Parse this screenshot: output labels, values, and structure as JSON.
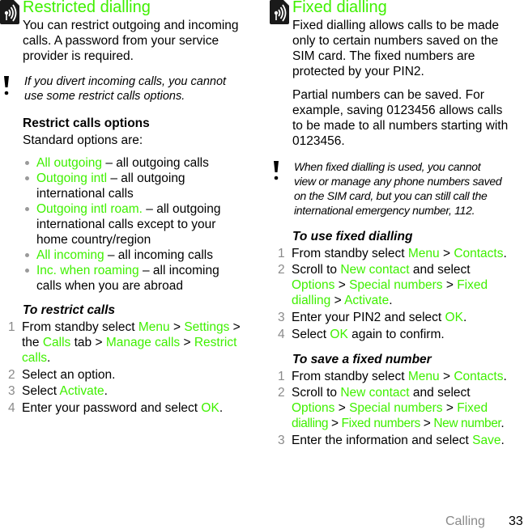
{
  "left": {
    "title": "Restricted dialling",
    "icon": "network-service-icon",
    "intro": [
      "You can restrict outgoing and incoming",
      "calls. A password from your service",
      "provider is required."
    ],
    "note": {
      "icon": "exclamation-icon",
      "lines": [
        "If you divert incoming calls, you cannot",
        "use some restrict calls options."
      ]
    },
    "options_heading": "Restrict calls options",
    "options_intro": "Standard options are:",
    "options": [
      {
        "name": "All outgoing",
        "desc_lines": [
          "– all outgoing calls"
        ]
      },
      {
        "name": "Outgoing intl",
        "desc_lines": [
          "– all outgoing",
          "international calls"
        ]
      },
      {
        "name": "Outgoing intl roam.",
        "desc_lines": [
          "– all outgoing",
          "international calls except to your",
          "home country/region"
        ]
      },
      {
        "name": "All incoming",
        "desc_lines": [
          "– all incoming calls"
        ]
      },
      {
        "name": "Inc. when roaming",
        "desc_lines": [
          "– all incoming",
          "calls when you are abroad"
        ]
      }
    ],
    "procedure": {
      "title": "To restrict calls",
      "steps": [
        {
          "num": "1",
          "t1": "From standby select ",
          "menu": "Menu",
          "sep1": " > ",
          "settings": "Settings",
          "sep2": " >",
          "t2": "the ",
          "calls_tab": "Calls",
          "t3": " tab > ",
          "manage": "Manage calls",
          "sep3": " > ",
          "restrict": "Restrict",
          "restrict2": "calls",
          "end": "."
        },
        {
          "num": "2",
          "text": "Select an option."
        },
        {
          "num": "3",
          "pre": "Select ",
          "link": "Activate",
          "post": "."
        },
        {
          "num": "4",
          "pre": "Enter your password and select ",
          "link": "OK",
          "post": "."
        }
      ]
    }
  },
  "right": {
    "title": "Fixed dialling",
    "icon": "network-service-icon",
    "intro": [
      "Fixed dialling allows calls to be made",
      "only to certain numbers saved on the",
      "SIM card. The fixed numbers are",
      "protected by your PIN2."
    ],
    "intro2": [
      "Partial numbers can be saved. For",
      "example, saving 0123456 allows calls",
      "to be made to all numbers starting with",
      "0123456."
    ],
    "note": {
      "icon": "exclamation-icon",
      "lines": [
        "When fixed dialling is used, you cannot",
        "view or manage any phone numbers saved",
        "on the SIM card, but you can still call the",
        "international emergency number, 112."
      ]
    },
    "use_procedure": {
      "title": "To use fixed dialling",
      "steps": [
        {
          "num": "1",
          "pre": "From standby select ",
          "a": "Menu",
          "sep": " > ",
          "b": "Contacts",
          "post": "."
        },
        {
          "num": "2",
          "pre": "Scroll to ",
          "a": "New contact",
          "mid": " and select",
          "b": "Options",
          "sep1": " > ",
          "c": "Special numbers",
          "sep2": " > ",
          "d": "Fixed",
          "e": "dialling",
          "sep3": " > ",
          "f": "Activate",
          "post": "."
        },
        {
          "num": "3",
          "pre": "Enter your PIN2 and select ",
          "a": "OK",
          "post": "."
        },
        {
          "num": "4",
          "pre": "Select ",
          "a": "OK",
          "post": " again to confirm."
        }
      ]
    },
    "save_procedure": {
      "title": "To save a fixed number",
      "steps": [
        {
          "num": "1",
          "pre": "From standby select ",
          "a": "Menu",
          "sep": " > ",
          "b": "Contacts",
          "post": "."
        },
        {
          "num": "2",
          "pre": "Scroll to ",
          "a": "New contact",
          "mid": " and select",
          "b": "Options",
          "sep1": " > ",
          "c": "Special numbers",
          "sep2": " > ",
          "d": "Fixed",
          "e": "dialling",
          "sep3": " > ",
          "f": "Fixed numbers",
          "sep4": " > ",
          "g": "New number",
          "post": "."
        },
        {
          "num": "3",
          "pre": "Enter the information and select ",
          "a": "Save",
          "post": "."
        }
      ]
    }
  },
  "footer": {
    "section": "Calling",
    "page": "33"
  },
  "colors": {
    "accent": "#3ff000",
    "muted": "#8a8a8a",
    "text": "#000000"
  }
}
